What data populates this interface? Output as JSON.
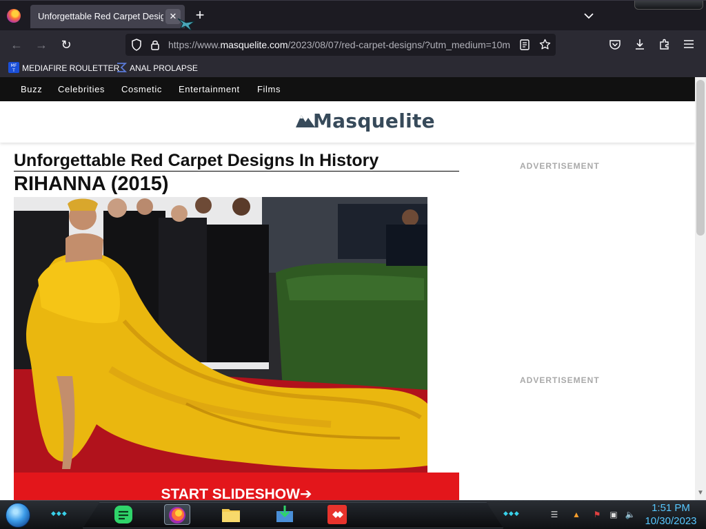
{
  "browser": {
    "tab": {
      "title": "Unforgettable Red Carpet Designs In History",
      "close_glyph": "✕"
    },
    "new_tab_glyph": "+",
    "nav": {
      "back": "←",
      "forward": "→",
      "reload": "↻"
    },
    "url": {
      "prefix": "https://www.",
      "domain": "masquelite.com",
      "path": "/2023/08/07/red-carpet-designs/?utm_medium=10m"
    },
    "bookmarks": [
      {
        "label": "MEDIAFIRE ROULETTER",
        "icon": "mediafire-icon"
      },
      {
        "label": "ANAL PROLAPSE",
        "icon": "sigma-icon"
      }
    ]
  },
  "site": {
    "nav_items": [
      "Buzz",
      "Celebrities",
      "Cosmetic",
      "Entertainment",
      "Films"
    ],
    "logo_text": "Masquelite",
    "article_title": "Unforgettable Red Carpet Designs In History",
    "slide_title": "RIHANNA (2015)",
    "slideshow_button": "START SLIDESHOW➔",
    "ad_label": "ADVERTISEMENT"
  },
  "taskbar": {
    "time": "1:51 PM",
    "date": "10/30/2023"
  },
  "colors": {
    "accent_red": "#e3161b",
    "site_nav_bg": "#111111",
    "browser_bg": "#1c1b22",
    "clock": "#58c8ff"
  }
}
